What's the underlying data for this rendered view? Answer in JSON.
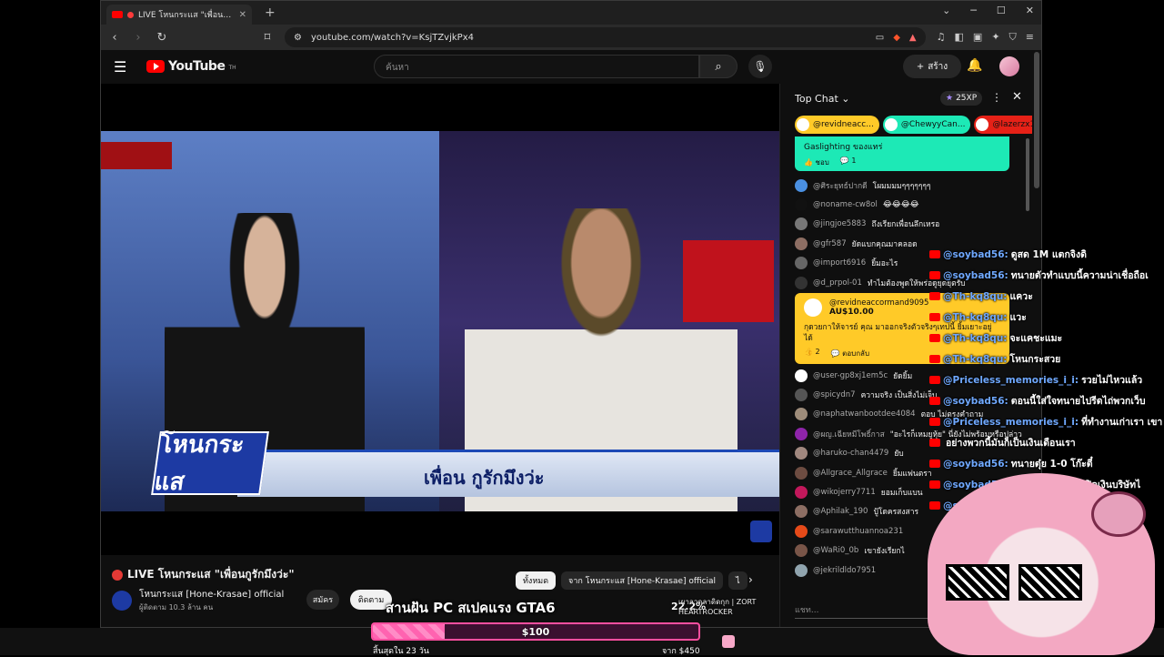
{
  "browser": {
    "tab_title": "LIVE โหนกระแส \"เพื่อนกูรักมึงว่ะ\"",
    "url": "youtube.com/watch?v=KsjTZvjkPx4"
  },
  "header": {
    "logo": "YouTube",
    "logo_sup": "TH",
    "search_placeholder": "ค้นหา",
    "create_label": "สร้าง"
  },
  "video": {
    "lower_third": "เพื่อน กูรักมึงว่ะ",
    "show_logo": "โหนกระแส"
  },
  "below": {
    "title": "LIVE โหนกระแส \"เพื่อนกูรักมึงว่ะ\"",
    "channel": "โหนกระแส [Hone-Krasae] official",
    "subs": "ผู้ติดตาม 10.3 ล้าน คน",
    "join": "สมัคร",
    "subscribe": "ติดตาม",
    "chips": [
      "ทั้งหมด",
      "จาก โหนกระแส [Hone-Krasae] official",
      "ไ"
    ]
  },
  "chat": {
    "mode": "Top Chat",
    "xp": "25XP",
    "tickers": [
      {
        "name": "@revidneacc...",
        "color": "#ffca28"
      },
      {
        "name": "@ChewyyCan...",
        "color": "#1de9b6"
      },
      {
        "name": "@lazerzx1",
        "color": "#e62117"
      }
    ],
    "pinned_text": "Gaslighting ของแทร่",
    "pinned_like": "ชอบ",
    "pinned_reply": "1",
    "messages_top": [
      {
        "author": "@ศิระยุทธ์ปากดี",
        "text": "โผมมมมๆๆๆๆๆๆๆ",
        "color": "#4a90e2"
      },
      {
        "author": "@noname-cw8ol",
        "text": "😂😂😂😂",
        "color": "#111111"
      },
      {
        "author": "@jingjoe5883",
        "text": "ถึงเรียกเพื่อนลึกเหรอ",
        "color": "#777777"
      },
      {
        "author": "@gfr587",
        "text": "ยัดแบกคุณมาคลอด",
        "color": "#8d6e63"
      },
      {
        "author": "@import6916",
        "text": "ยิ้มอะไร",
        "color": "#666666"
      },
      {
        "author": "@d_prpol-01",
        "text": "ทำไมต้องพูดให้พร่อดูยุดยุตรับ",
        "color": "#333333"
      }
    ],
    "superchat": {
      "author": "@revidneaccormand9095",
      "amount": "AU$10.00",
      "text": "กุดวยกาให้จารย์ คุณ มาออกจริงตัวจริงๆเทปนี้ ยิ้มเยาะอยู่ได้",
      "likes": "2",
      "reply": "ตอบกลับ"
    },
    "messages_bottom": [
      {
        "author": "@user-gp8xj1em5c",
        "text": "ยัดยิ้ม",
        "color": "#ffffff"
      },
      {
        "author": "@spicydn7",
        "text": "ความจริง เป็นสิ่งไม่เจ็บ",
        "color": "#555555"
      },
      {
        "author": "@naphatwanbootdee4084",
        "text": "ตอบ ไม่ตรงคำถาม",
        "color": "#9e8c7a"
      },
      {
        "author": "@ผญ.เฉียหมีโพธิ์กาส",
        "text": "\"อะไรก็เหมยูหุ้ย\" นี่ยังไม่พร้อมหรือปล่าวหว่า",
        "color": "#8e24aa"
      },
      {
        "author": "@haruko-chan4479",
        "text": "ยับ",
        "color": "#a1887f"
      },
      {
        "author": "@Allgrace_Allgrace",
        "text": "ยิ้มแฟนตรา",
        "color": "#6d4c41"
      },
      {
        "author": "@wikojerry7711",
        "text": "ยอมเก็บแบน",
        "color": "#c2185b"
      },
      {
        "author": "@Aphilak_190",
        "text": "ปู้โดครสงสาร",
        "color": "#8d6e63"
      },
      {
        "author": "@sarawutthuannoa231",
        "text": "",
        "color": "#e64a19"
      },
      {
        "author": "@WaRi0_0b",
        "text": "เขายังเรียกไ",
        "color": "#795548"
      },
      {
        "author": "@jekrildldo7951",
        "text": "",
        "color": "#90a4ae"
      }
    ],
    "input_placeholder": "แชท..."
  },
  "overlay_chat": [
    {
      "name": "@soybad56:",
      "text": "ดูสด 1M แตกจิงดิ"
    },
    {
      "name": "@soybad56:",
      "text": "ทนายตัวทำแบบนี้ความน่าเชื่อถือเ"
    },
    {
      "name": "@Th-kq8qu:",
      "text": "แควะ"
    },
    {
      "name": "@Th-kq8qu:",
      "text": "แวะ"
    },
    {
      "name": "@Th-kq8qu:",
      "text": "จะแคชะแมะ"
    },
    {
      "name": "@Th-kq8qu:",
      "text": "โหนกระสวย"
    },
    {
      "name": "@Priceless_memories_i_i:",
      "text": "รวยไม่ไหวแล้ว"
    },
    {
      "name": "@soybad56:",
      "text": "ตอนนี้ใส่ใจทนายไปรีดไถ่พวกเว็บ"
    },
    {
      "name": "@Priceless_memories_i_i:",
      "text": "ที่ทำงานเก่าเรา เขา"
    },
    {
      "name": "",
      "text": "อย่างพวกนี้มันก็เป็นเงินเดือนเรา"
    },
    {
      "name": "@soybad56:",
      "text": "ทนายตุ๋ย 1-0 โก๊ะตี๋"
    },
    {
      "name": "@soybad56:",
      "text": "บัญชีตามไปเพิ่งว่าปิดเงินบริษัทไ"
    },
    {
      "name": "@soybad56:",
      "text": "นักนายพอสตุย มนนี่ทำกำโก๊ะตี"
    }
  ],
  "stream_overlay": {
    "banner": "สานฝัน PC สเปคแรง GTA6",
    "goal_amount": "$100",
    "goal_percent": "22.2%",
    "goal_progress": 0.222,
    "goal_left": "สิ้นสุดใน 23 วัน",
    "goal_right": "จาก $450",
    "music_line1": "เผาลวดลาดิดกุก | ZORT",
    "music_line2": "HEARTROCKER"
  }
}
